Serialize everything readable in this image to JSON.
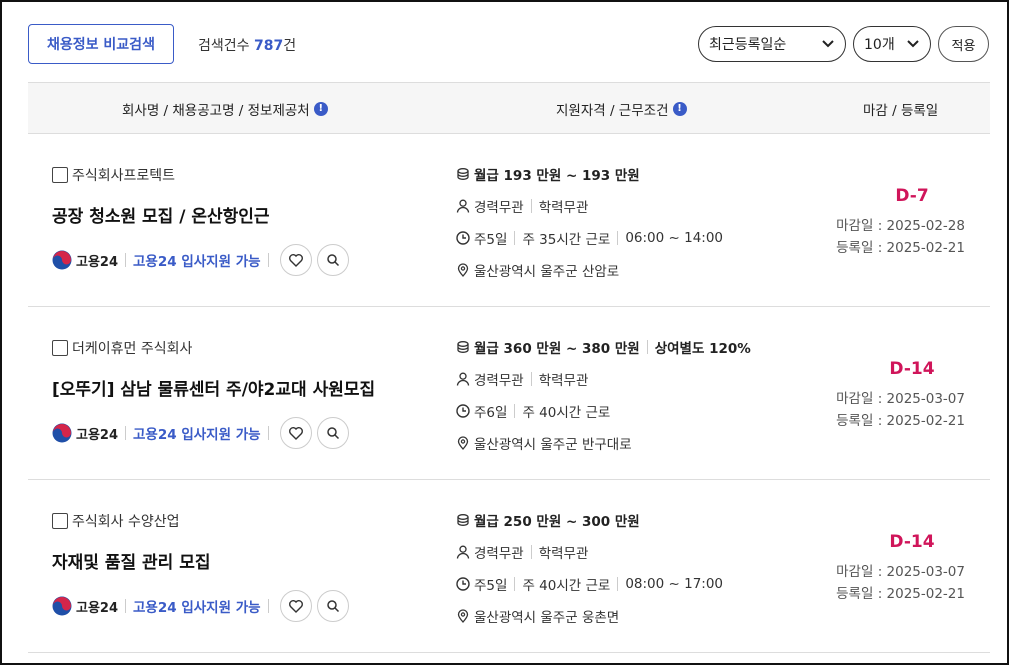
{
  "toolbar": {
    "compare_label": "채용정보 비교검색",
    "count_prefix": "검색건수 ",
    "count_value": "787",
    "count_suffix": "건",
    "sort_value": "최근등록일순",
    "size_value": "10개",
    "apply_label": "적용"
  },
  "table": {
    "headers": [
      "회사명 / 채용공고명 / 정보제공처",
      "지원자격 / 근무조건",
      "마감 / 등록일"
    ]
  },
  "rows": [
    {
      "company": "주식회사프로텍트",
      "title": "공장 청소원 모집 / 온산항인근",
      "source": "고용24",
      "apply_link": "고용24 입사지원 가능",
      "salary": "월급 193 만원 ~ 193 만원",
      "bonus": "",
      "career": "경력무관",
      "education": "학력무관",
      "days": "주5일",
      "hours": "주 35시간 근로",
      "time": "06:00 ~ 14:00",
      "location": "울산광역시 울주군 산암로",
      "dday": "D-7",
      "deadline": "마감일 : 2025-02-28",
      "registered": "등록일 : 2025-02-21"
    },
    {
      "company": "더케이휴먼 주식회사",
      "title": "[오뚜기] 삼남 물류센터 주/야2교대 사원모집",
      "source": "고용24",
      "apply_link": "고용24 입사지원 가능",
      "salary": "월급 360 만원 ~ 380 만원",
      "bonus": "상여별도 120%",
      "career": "경력무관",
      "education": "학력무관",
      "days": "주6일",
      "hours": "주 40시간 근로",
      "time": "",
      "location": "울산광역시 울주군 반구대로",
      "dday": "D-14",
      "deadline": "마감일 : 2025-03-07",
      "registered": "등록일 : 2025-02-21"
    },
    {
      "company": "주식회사 수양산업",
      "title": "자재및 품질 관리 모집",
      "source": "고용24",
      "apply_link": "고용24 입사지원 가능",
      "salary": "월급 250 만원 ~ 300 만원",
      "bonus": "",
      "career": "경력무관",
      "education": "학력무관",
      "days": "주5일",
      "hours": "주 40시간 근로",
      "time": "08:00 ~ 17:00",
      "location": "울산광역시 울주군 웅촌면",
      "dday": "D-14",
      "deadline": "마감일 : 2025-03-07",
      "registered": "등록일 : 2025-02-21"
    }
  ],
  "colors": {
    "accent": "#3a5bc7",
    "dday": "#d0155a"
  },
  "icons": {
    "info": "info-icon",
    "salary": "coins-icon",
    "career": "person-icon",
    "work": "clock-icon",
    "location": "map-pin-icon",
    "favorite": "heart-icon",
    "view": "search-icon",
    "source_logo": "taegeuk-logo"
  }
}
